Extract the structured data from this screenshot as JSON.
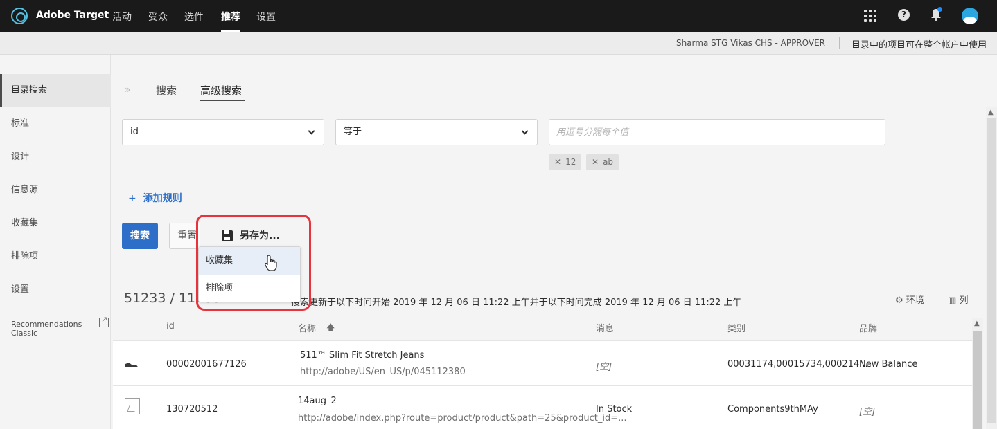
{
  "app": {
    "brand": "Adobe Target"
  },
  "nav": {
    "items": [
      "活动",
      "受众",
      "选件",
      "推荐",
      "设置"
    ],
    "active": "推荐"
  },
  "subheader": {
    "account": "Sharma STG Vikas CHS - APPROVER",
    "note": "目录中的项目可在整个帐户中使用"
  },
  "sidebar": {
    "items": [
      "目录搜索",
      "标准",
      "设计",
      "信息源",
      "收藏集",
      "排除项",
      "设置"
    ],
    "active": "目录搜索",
    "classic_link": "Recommendations Classic"
  },
  "tabs": {
    "chevron": "»",
    "search": "搜索",
    "advanced": "高级搜索",
    "active": "高级搜索"
  },
  "rule": {
    "field": "id",
    "operator": "等于",
    "value_placeholder": "用逗号分隔每个值",
    "tags": [
      "12",
      "ab"
    ]
  },
  "actions": {
    "add_rule": "添加规则",
    "search": "搜索",
    "reset": "重置",
    "save_as": "另存为...",
    "save_as_menu": [
      "收藏集",
      "排除项"
    ]
  },
  "results": {
    "count": "51233 / 11200",
    "note": "搜索更新于以下时间开始 2019 年 12 月 06 日 11:22 上午并于以下时间完成 2019 年 12 月 06 日 11:22 上午",
    "environment_label": "环境",
    "columns_label": "列"
  },
  "table": {
    "headers": {
      "id": "id",
      "name": "名称",
      "message": "消息",
      "category": "类别",
      "brand": "品牌"
    },
    "rows": [
      {
        "id": "00002001677126",
        "name": "511™ Slim Fit Stretch Jeans",
        "url": "http://adobe/US/en_US/p/045112380",
        "message": "[空]",
        "category": "00031174,00015734,000214...",
        "brand": "New Balance"
      },
      {
        "id": "130720512",
        "name": "14aug_2",
        "url": "http://adobe/index.php?route=product/product&path=25&product_id=...",
        "message": "In Stock",
        "category": "Components9thMAy",
        "brand": "[空]"
      }
    ]
  },
  "colors": {
    "topbar": "#1a1a1a",
    "accent": "#2d6ec9",
    "highlight": "#e8323c"
  },
  "icons": [
    "adobe-target-logo-icon",
    "apps-grid-icon",
    "help-icon",
    "bell-icon",
    "avatar",
    "external-link-icon",
    "floppy-disk-icon",
    "hand-cursor-icon",
    "gear-icon",
    "columns-icon",
    "sort-up-icon",
    "shoe-icon",
    "image-placeholder-icon"
  ]
}
